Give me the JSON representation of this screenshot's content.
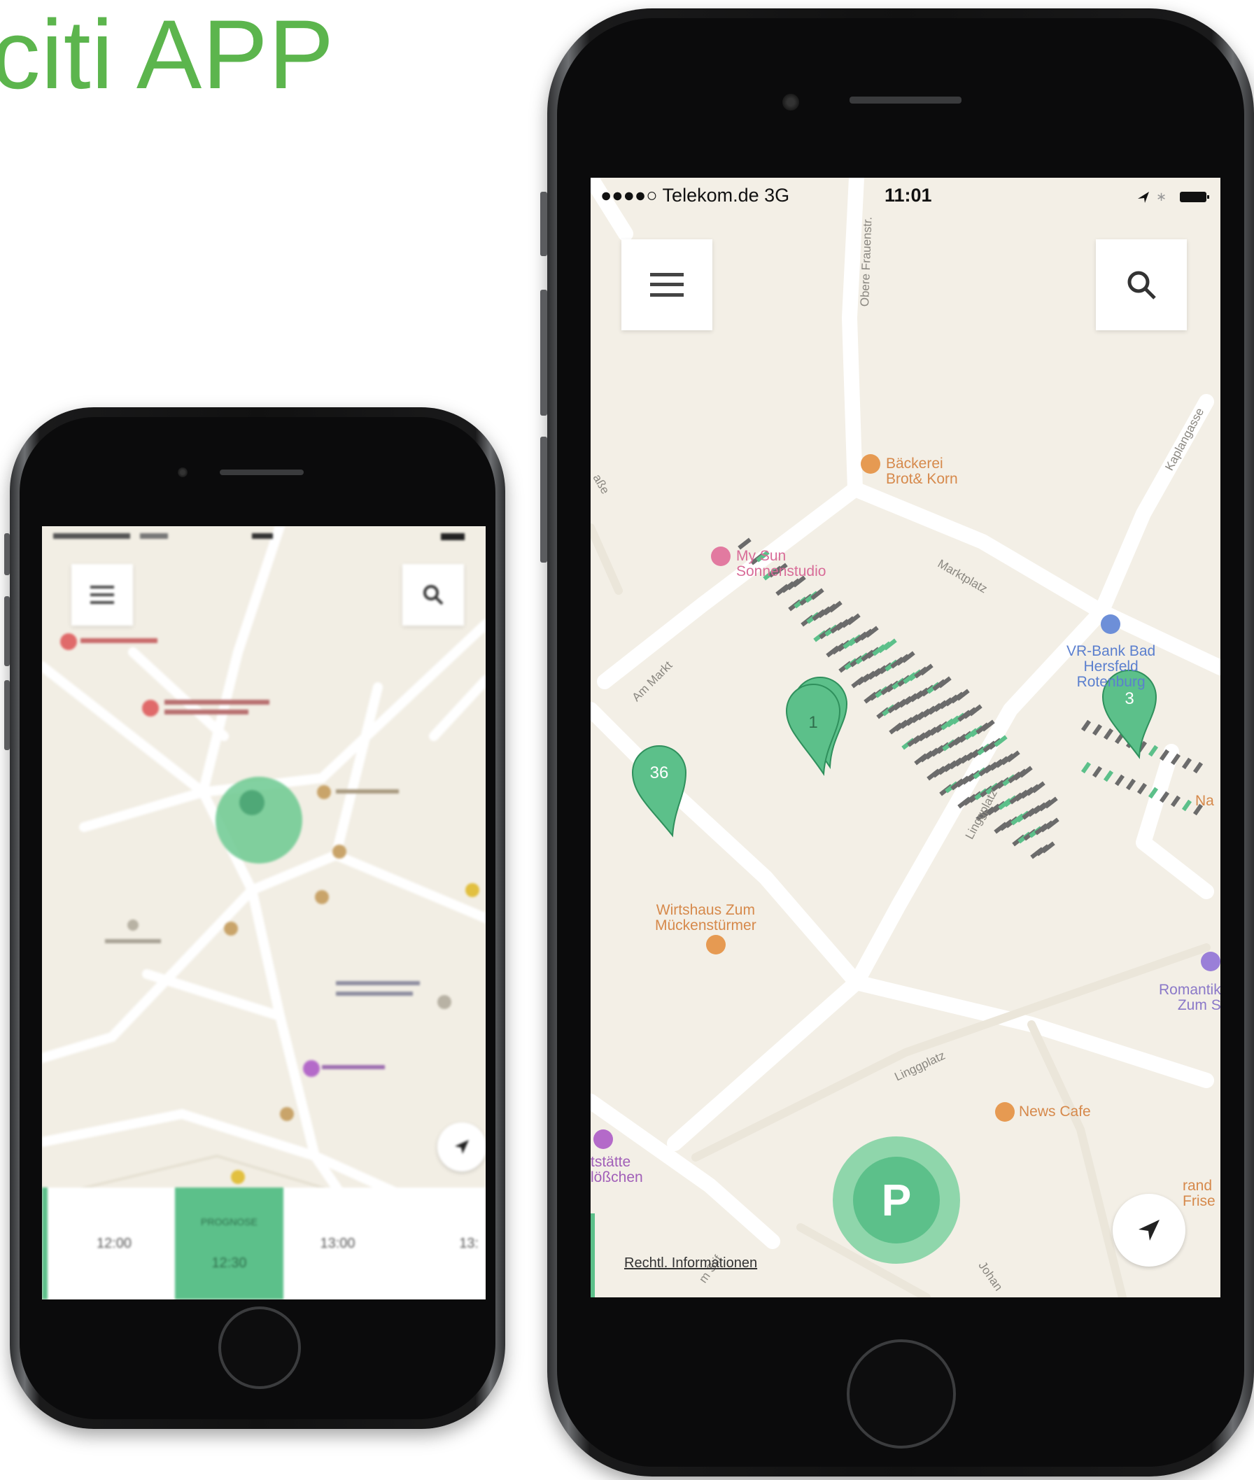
{
  "heading": "rciti APP",
  "large_phone": {
    "status_bar": {
      "carrier": "●●●●○ Telekom.de  3G",
      "time": "11:01"
    },
    "map": {
      "poi_labels": {
        "baeckerei": "Bäckerei\nBrot& Korn",
        "sonnenstudio": "My Sun\nSonnenstudio",
        "vr_bank": "VR-Bank Bad\nHersfeld\nRotenburg",
        "wirtshaus": "Wirtshaus Zum\nMückenstürmer",
        "romantik": "Romantik\nZum S",
        "news_cafe": "News Cafe",
        "gaststaette": "tstätte\nlößchen",
        "friseur": "rand\nFrise",
        "na": "Na"
      },
      "road_labels": {
        "obere": "Obere Frauenstr.",
        "marktplatz": "Marktplatz",
        "am_markt": "Am Markt",
        "linggplatz_1": "Linggplatz",
        "linggplatz_2": "Linggplatz",
        "kaplangasse": "Kaplangasse",
        "strasse": "aße",
        "johann": "Johan",
        "stift": "m Stif"
      },
      "pins": [
        {
          "label": "36"
        },
        {
          "label": "1"
        },
        {
          "label": "3"
        }
      ],
      "parking_button": "P",
      "legal": "Rechtl. Informationen"
    },
    "colors": {
      "accent": "#5cc08a",
      "occupied": "#6b6b6b",
      "map_bg": "#f3efe6"
    }
  },
  "small_phone": {
    "time_slots": [
      "12:00",
      "12:30",
      "13:00",
      "13:"
    ],
    "selected_header": "PROGNOSE"
  }
}
